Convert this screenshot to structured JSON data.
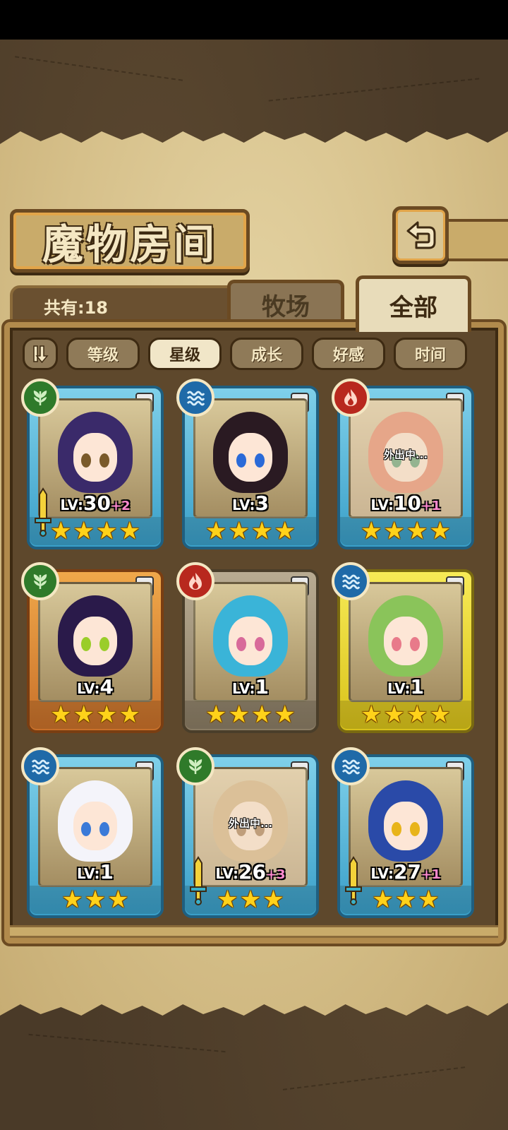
{
  "header": {
    "title": "魔物房间"
  },
  "count": {
    "label": "共有:18"
  },
  "tabs": [
    {
      "label": "牧场",
      "active": false
    },
    {
      "label": "全部",
      "active": true
    }
  ],
  "sort_buttons": [
    "等级",
    "星级",
    "成长",
    "好感",
    "时间"
  ],
  "sort_active": "星级",
  "cards": [
    {
      "element": "wind",
      "rarity": "A",
      "frame": "blue",
      "lv_prefix": "LV:",
      "lv": "30",
      "plus": "+2",
      "stars": 4,
      "equipped": true,
      "away": false,
      "hair": "#3a2a6a",
      "eyes": "#7a5a2a"
    },
    {
      "element": "water",
      "rarity": "A",
      "frame": "blue",
      "lv_prefix": "LV:",
      "lv": "3",
      "plus": "",
      "stars": 4,
      "equipped": false,
      "away": false,
      "hair": "#2a1a22",
      "eyes": "#2a6ad8"
    },
    {
      "element": "fire",
      "rarity": "A",
      "frame": "blue",
      "lv_prefix": "LV:",
      "lv": "10",
      "plus": "+1",
      "stars": 4,
      "equipped": false,
      "away": true,
      "away_text": "外出中...",
      "hair": "#e06a4a",
      "eyes": "#2a8a5a"
    },
    {
      "element": "wind",
      "rarity": "B",
      "frame": "orange",
      "lv_prefix": "LV:",
      "lv": "4",
      "plus": "",
      "stars": 4,
      "equipped": false,
      "away": false,
      "hair": "#2a1a4a",
      "eyes": "#9acd2a"
    },
    {
      "element": "fire",
      "rarity": "C",
      "frame": "gray",
      "lv_prefix": "LV:",
      "lv": "1",
      "plus": "",
      "stars": 4,
      "equipped": false,
      "away": false,
      "hair": "#3ab4d8",
      "eyes": "#d86a9a"
    },
    {
      "element": "water",
      "rarity": "S",
      "frame": "gold",
      "lv_prefix": "LV:",
      "lv": "1",
      "plus": "",
      "stars": 4,
      "equipped": false,
      "away": false,
      "hair": "#8ac45a",
      "eyes": "#e87a8a"
    },
    {
      "element": "water",
      "rarity": "A",
      "frame": "blue",
      "lv_prefix": "LV:",
      "lv": "1",
      "plus": "",
      "stars": 3,
      "equipped": false,
      "away": false,
      "hair": "#f4f4fa",
      "eyes": "#3a7ad8"
    },
    {
      "element": "wind",
      "rarity": "A",
      "frame": "blue",
      "lv_prefix": "LV:",
      "lv": "26",
      "plus": "+3",
      "stars": 3,
      "equipped": true,
      "away": true,
      "away_text": "外出中...",
      "hair": "#c8a46a",
      "eyes": "#8a5a2a"
    },
    {
      "element": "water",
      "rarity": "A",
      "frame": "blue",
      "lv_prefix": "LV:",
      "lv": "27",
      "plus": "+1",
      "stars": 3,
      "equipped": true,
      "away": false,
      "hair": "#2a4aa8",
      "eyes": "#e8b41a"
    }
  ]
}
